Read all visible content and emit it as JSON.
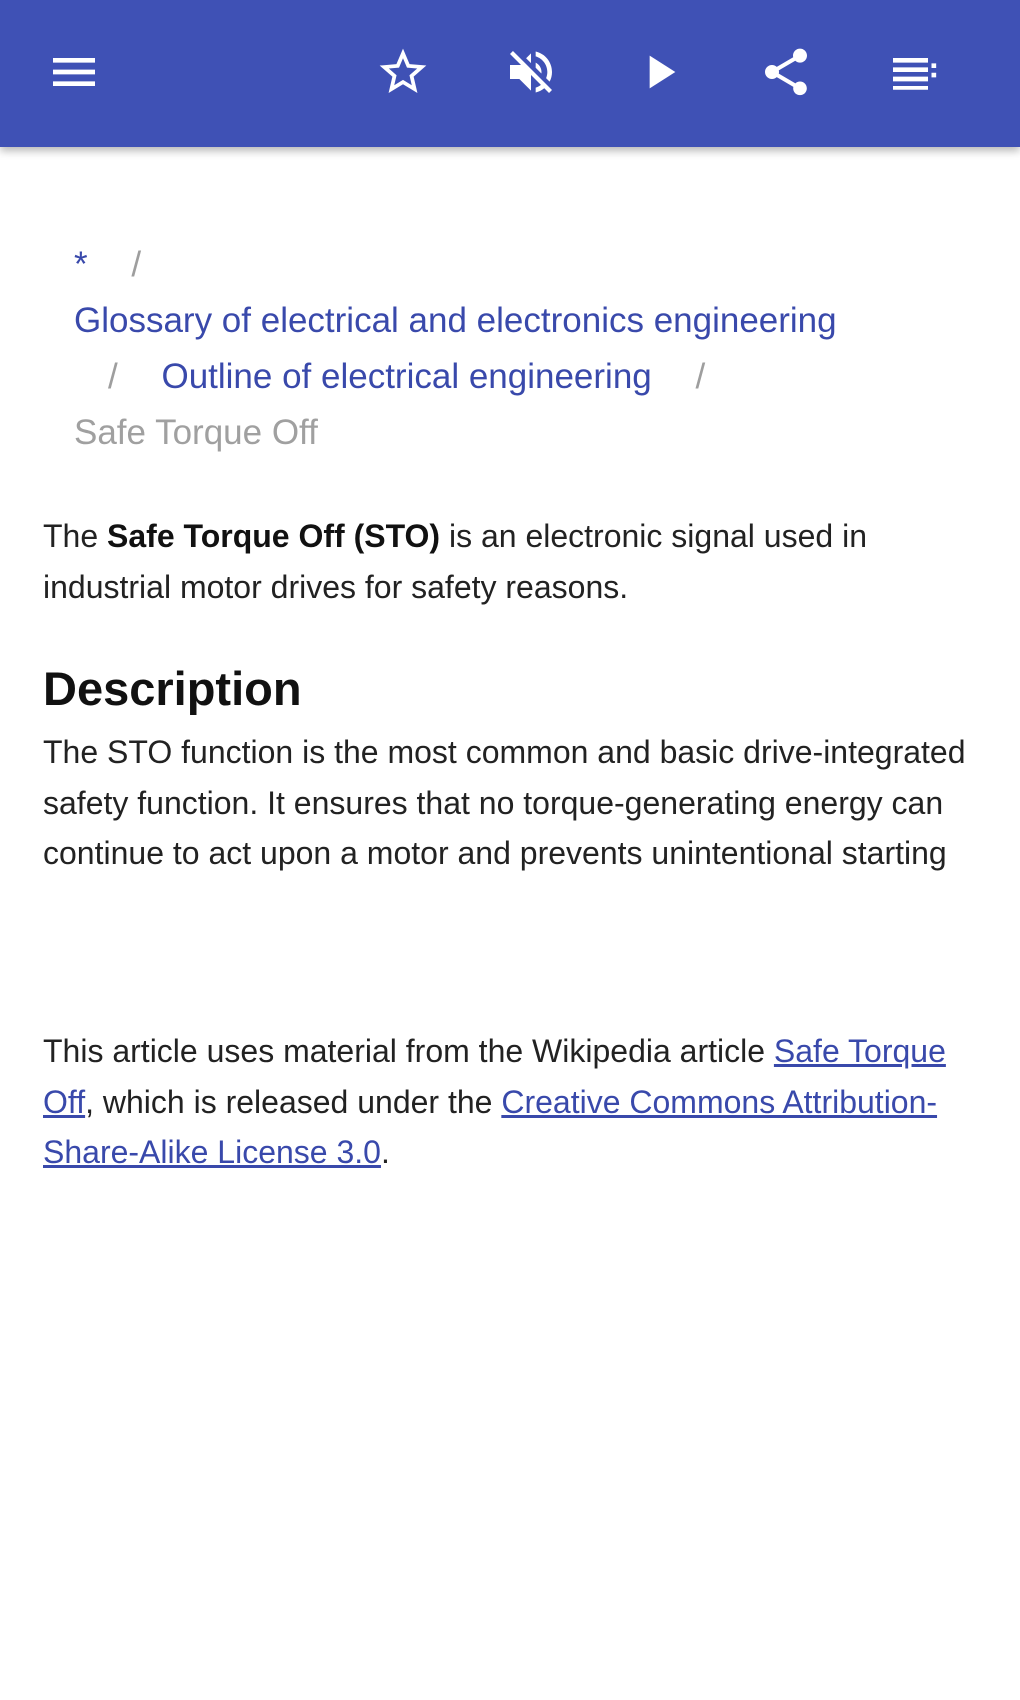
{
  "toolbar": {
    "background": "#3f51b5",
    "icons": [
      "menu-icon",
      "star-outline-icon",
      "volume-off-icon",
      "play-icon",
      "share-icon",
      "playlist-icon"
    ]
  },
  "breadcrumb": {
    "home": "*",
    "separator": "/",
    "level1": "Glossary of electrical and electronics engineering",
    "level2": "Outline of electrical engineering",
    "current": "Safe Torque Off"
  },
  "article": {
    "intro_prefix": "The ",
    "intro_bold": "Safe Torque Off (STO)",
    "intro_suffix": " is an electronic signal used in industrial motor drives for safety reasons.",
    "heading": "Description",
    "description": "The STO function is the most common and basic drive-integrated safety function. It ensures that no torque-generating energy can continue to act upon a motor and prevents unintentional starting",
    "license_prefix": "This article uses material from the Wikipedia article ",
    "license_link1": "Safe Torque Off",
    "license_middle": ", which is released under the ",
    "license_link2": "Creative Commons Attribution-Share-Alike License 3.0",
    "license_suffix": "."
  },
  "colors": {
    "link": "#3949ab",
    "muted": "#9e9e9e",
    "text": "#222222"
  }
}
